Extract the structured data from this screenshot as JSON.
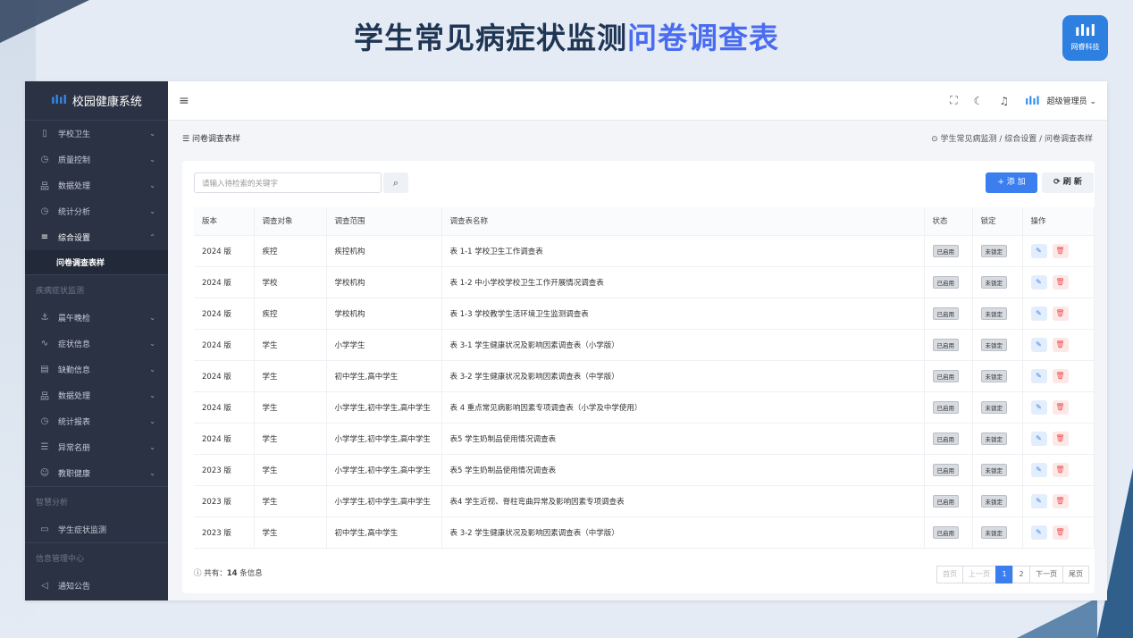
{
  "banner": {
    "title_main": "学生常见病症状监测",
    "title_highlight": "问卷调查表",
    "logo_text": "网睿科技"
  },
  "app": {
    "title": "校园健康系统"
  },
  "sidebar": {
    "items": [
      {
        "label": "学校卫生",
        "icon": "▯"
      },
      {
        "label": "质量控制",
        "icon": "◷"
      },
      {
        "label": "数据处理",
        "icon": "品"
      },
      {
        "label": "统计分析",
        "icon": "◷"
      },
      {
        "label": "综合设置",
        "icon": "≡"
      }
    ],
    "active_sub": "问卷调查表样",
    "group1": "疾病症状监测",
    "items2": [
      {
        "label": "晨午晚检",
        "icon": "⚓"
      },
      {
        "label": "症状信息",
        "icon": "∿"
      },
      {
        "label": "缺勤信息",
        "icon": "▤"
      },
      {
        "label": "数据处理",
        "icon": "品"
      },
      {
        "label": "统计报表",
        "icon": "◷"
      },
      {
        "label": "异常名册",
        "icon": "☰"
      },
      {
        "label": "教职健康",
        "icon": "☺"
      }
    ],
    "group2": "智慧分析",
    "item3": {
      "label": "学生症状监测",
      "icon": "▭"
    },
    "group3": "信息管理中心",
    "item4": {
      "label": "通知公告",
      "icon": "◁"
    }
  },
  "topbar": {
    "user": "超级管理员"
  },
  "crumbs": {
    "page_title": "问卷调查表样",
    "path": "学生常见病监测 / 综合设置 / 问卷调查表样"
  },
  "toolbar": {
    "search_placeholder": "请输入待检索的关键字",
    "add_label": "+ 添 加",
    "refresh_label": "刷 新"
  },
  "table": {
    "headers": [
      "版本",
      "调查对象",
      "调查范围",
      "调查表名称",
      "状态",
      "锁定",
      "操作"
    ],
    "rows": [
      {
        "ver": "2024 版",
        "target": "疾控",
        "scope": "疾控机构",
        "name": "表 1-1 学校卫生工作调查表",
        "status": "已启用",
        "lock": "未锁定"
      },
      {
        "ver": "2024 版",
        "target": "学校",
        "scope": "学校机构",
        "name": "表 1-2 中小学校学校卫生工作开展情况调查表",
        "status": "已启用",
        "lock": "未锁定"
      },
      {
        "ver": "2024 版",
        "target": "疾控",
        "scope": "学校机构",
        "name": "表 1-3 学校教学生活环境卫生监测调查表",
        "status": "已启用",
        "lock": "未锁定"
      },
      {
        "ver": "2024 版",
        "target": "学生",
        "scope": "小学学生",
        "name": "表 3-1 学生健康状况及影响因素调查表（小学版）",
        "status": "已启用",
        "lock": "未锁定"
      },
      {
        "ver": "2024 版",
        "target": "学生",
        "scope": "初中学生,高中学生",
        "name": "表 3-2 学生健康状况及影响因素调查表（中学版）",
        "status": "已启用",
        "lock": "未锁定"
      },
      {
        "ver": "2024 版",
        "target": "学生",
        "scope": "小学学生,初中学生,高中学生",
        "name": "表 4 重点常见病影响因素专项调查表（小学及中学使用）",
        "status": "已启用",
        "lock": "未锁定"
      },
      {
        "ver": "2024 版",
        "target": "学生",
        "scope": "小学学生,初中学生,高中学生",
        "name": "表5 学生奶制品使用情况调查表",
        "status": "已启用",
        "lock": "未锁定"
      },
      {
        "ver": "2023 版",
        "target": "学生",
        "scope": "小学学生,初中学生,高中学生",
        "name": "表5 学生奶制品使用情况调查表",
        "status": "已启用",
        "lock": "未锁定"
      },
      {
        "ver": "2023 版",
        "target": "学生",
        "scope": "小学学生,初中学生,高中学生",
        "name": "表4 学生近视、脊柱弯曲异常及影响因素专项调查表",
        "status": "已启用",
        "lock": "未锁定"
      },
      {
        "ver": "2023 版",
        "target": "学生",
        "scope": "初中学生,高中学生",
        "name": "表 3-2 学生健康状况及影响因素调查表（中学版）",
        "status": "已启用",
        "lock": "未锁定"
      }
    ]
  },
  "footer": {
    "total_prefix": "ⓘ 共有：",
    "total_count": "14",
    "total_suffix": "条信息"
  },
  "pager": {
    "first": "首页",
    "prev": "上一页",
    "p1": "1",
    "p2": "2",
    "next": "下一页",
    "last": "尾页"
  }
}
